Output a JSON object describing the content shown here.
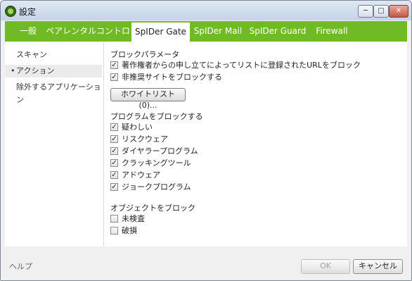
{
  "window": {
    "title": "設定",
    "controls": {
      "minimize": "─",
      "maximize": "□",
      "close": "✕"
    }
  },
  "tabs": [
    {
      "label": "一般",
      "active": false
    },
    {
      "label": "ペアレンタルコントロール",
      "active": false
    },
    {
      "label": "SpIDer Gate",
      "active": true
    },
    {
      "label": "SpIDer Mail",
      "active": false
    },
    {
      "label": "SpIDer Guard",
      "active": false
    },
    {
      "label": "Firewall",
      "active": false
    }
  ],
  "sidebar": {
    "items": [
      {
        "label": "スキャン",
        "active": false
      },
      {
        "label": "アクション",
        "active": true,
        "marker": "•"
      },
      {
        "label": "除外するアプリケーション",
        "active": false
      }
    ]
  },
  "main": {
    "block_params": {
      "title": "ブロックパラメータ",
      "options": [
        {
          "label": "著作権者からの申し立てによってリストに登録されたURLをブロック",
          "checked": true
        },
        {
          "label": "非推奨サイトをブロックする",
          "checked": true
        }
      ],
      "whitelist_button": "ホワイトリスト (0)..."
    },
    "block_programs": {
      "title": "プログラムをブロックする",
      "options": [
        {
          "label": "疑わしい",
          "checked": true
        },
        {
          "label": "リスクウェア",
          "checked": true
        },
        {
          "label": "ダイヤラープログラム",
          "checked": true
        },
        {
          "label": "クラッキングツール",
          "checked": true
        },
        {
          "label": "アドウェア",
          "checked": true
        },
        {
          "label": "ジョークプログラム",
          "checked": true
        }
      ]
    },
    "block_objects": {
      "title": "オブジェクトをブロック",
      "options": [
        {
          "label": "未検査",
          "checked": false
        },
        {
          "label": "破損",
          "checked": false
        }
      ]
    }
  },
  "footer": {
    "help": "ヘルプ",
    "ok": "OK",
    "cancel": "キャンセル"
  },
  "check_mark": "✓"
}
